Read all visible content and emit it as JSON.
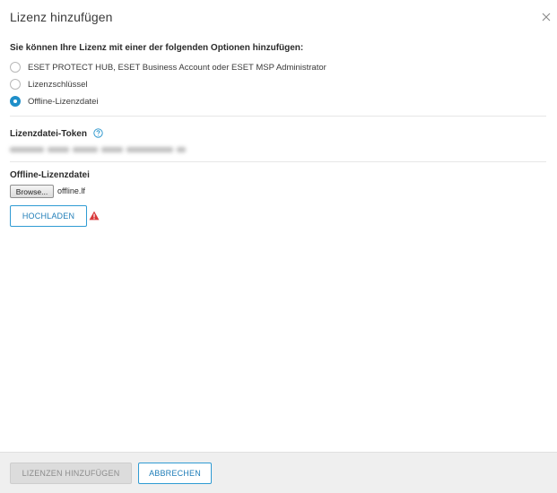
{
  "dialog": {
    "title": "Lizenz hinzufügen",
    "close_icon": "close-icon"
  },
  "options": {
    "heading": "Sie können Ihre Lizenz mit einer der folgenden Optionen hinzufügen:",
    "items": [
      {
        "label": "ESET PROTECT HUB, ESET Business Account oder ESET MSP Administrator",
        "selected": false
      },
      {
        "label": "Lizenzschlüssel",
        "selected": false
      },
      {
        "label": "Offline-Lizenzdatei",
        "selected": true
      }
    ]
  },
  "token": {
    "label": "Lizenzdatei-Token",
    "help_icon": "help-circle-icon",
    "value_hidden": true
  },
  "offline_file": {
    "label": "Offline-Lizenzdatei",
    "browse_label": "Browse...",
    "file_name": "offline.lf",
    "upload_label": "HOCHLADEN",
    "warning_icon": "warning-triangle-icon"
  },
  "footer": {
    "add_label": "LIZENZEN HINZUFÜGEN",
    "add_disabled": true,
    "cancel_label": "ABBRECHEN"
  },
  "colors": {
    "accent": "#1f8fc9",
    "warning": "#d9383a",
    "footer_bg": "#efefef"
  }
}
